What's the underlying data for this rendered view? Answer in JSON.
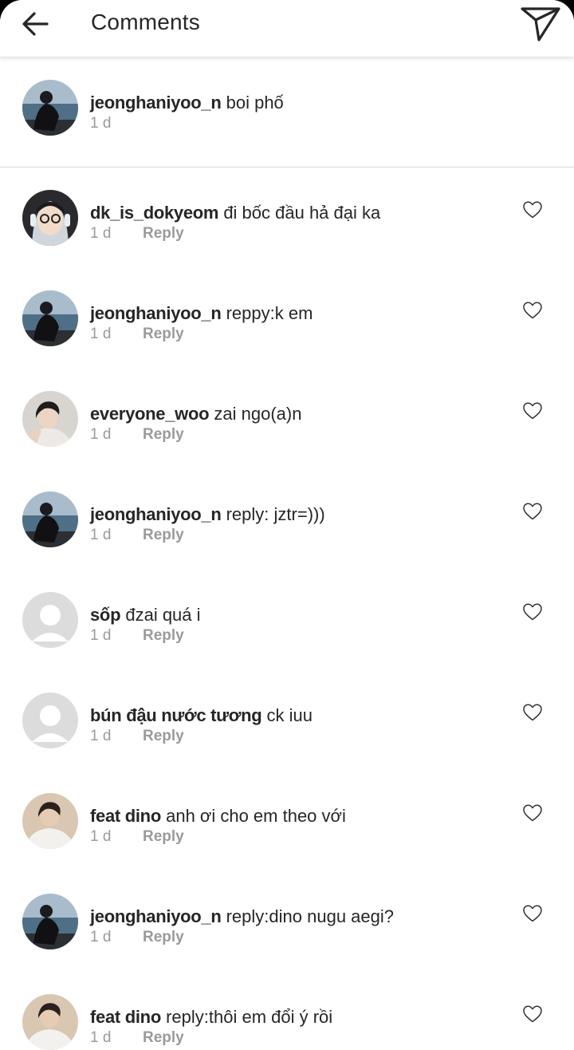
{
  "header": {
    "title": "Comments",
    "back_icon": "arrow-left-icon",
    "send_icon": "paper-plane-icon"
  },
  "caption": {
    "username": "jeonghaniyoo_n",
    "text": "boi phố",
    "time": "1 d",
    "avatar": "photo-person-by-sea"
  },
  "comments": [
    {
      "username": "dk_is_dokyeom",
      "text": "đi bốc đầu hả đại ka",
      "time": "1 d",
      "reply_label": "Reply",
      "avatar": "photo-glasses-headphones"
    },
    {
      "username": "jeonghaniyoo_n",
      "text": "reppy:k em",
      "time": "1 d",
      "reply_label": "Reply",
      "avatar": "photo-person-by-sea"
    },
    {
      "username": "everyone_woo",
      "text": "zai ngo(a)n",
      "time": "1 d",
      "reply_label": "Reply",
      "avatar": "photo-young-man"
    },
    {
      "username": "jeonghaniyoo_n",
      "text": "reply: jztr=)))",
      "time": "1 d",
      "reply_label": "Reply",
      "avatar": "photo-person-by-sea"
    },
    {
      "username": "sốp",
      "text": "đzai quá i",
      "time": "1 d",
      "reply_label": "Reply",
      "avatar": "default-avatar"
    },
    {
      "username": "bún đậu nước tương",
      "text": "ck iuu",
      "time": "1 d",
      "reply_label": "Reply",
      "avatar": "default-avatar"
    },
    {
      "username": "feat dino",
      "text": "anh ơi cho em theo với",
      "time": "1 d",
      "reply_label": "Reply",
      "avatar": "photo-man-white-shirt"
    },
    {
      "username": "jeonghaniyoo_n",
      "text": "reply:dino nugu aegi?",
      "time": "1 d",
      "reply_label": "Reply",
      "avatar": "photo-person-by-sea"
    },
    {
      "username": "feat dino",
      "text": "reply:thôi em đổi ý rồi",
      "time": "1 d",
      "reply_label": "Reply",
      "avatar": "photo-man-white-shirt"
    }
  ],
  "colors": {
    "text_primary": "#262626",
    "text_secondary": "#9a9a9a",
    "divider": "#dbdbdb",
    "default_avatar_bg": "#dcdcdc"
  }
}
